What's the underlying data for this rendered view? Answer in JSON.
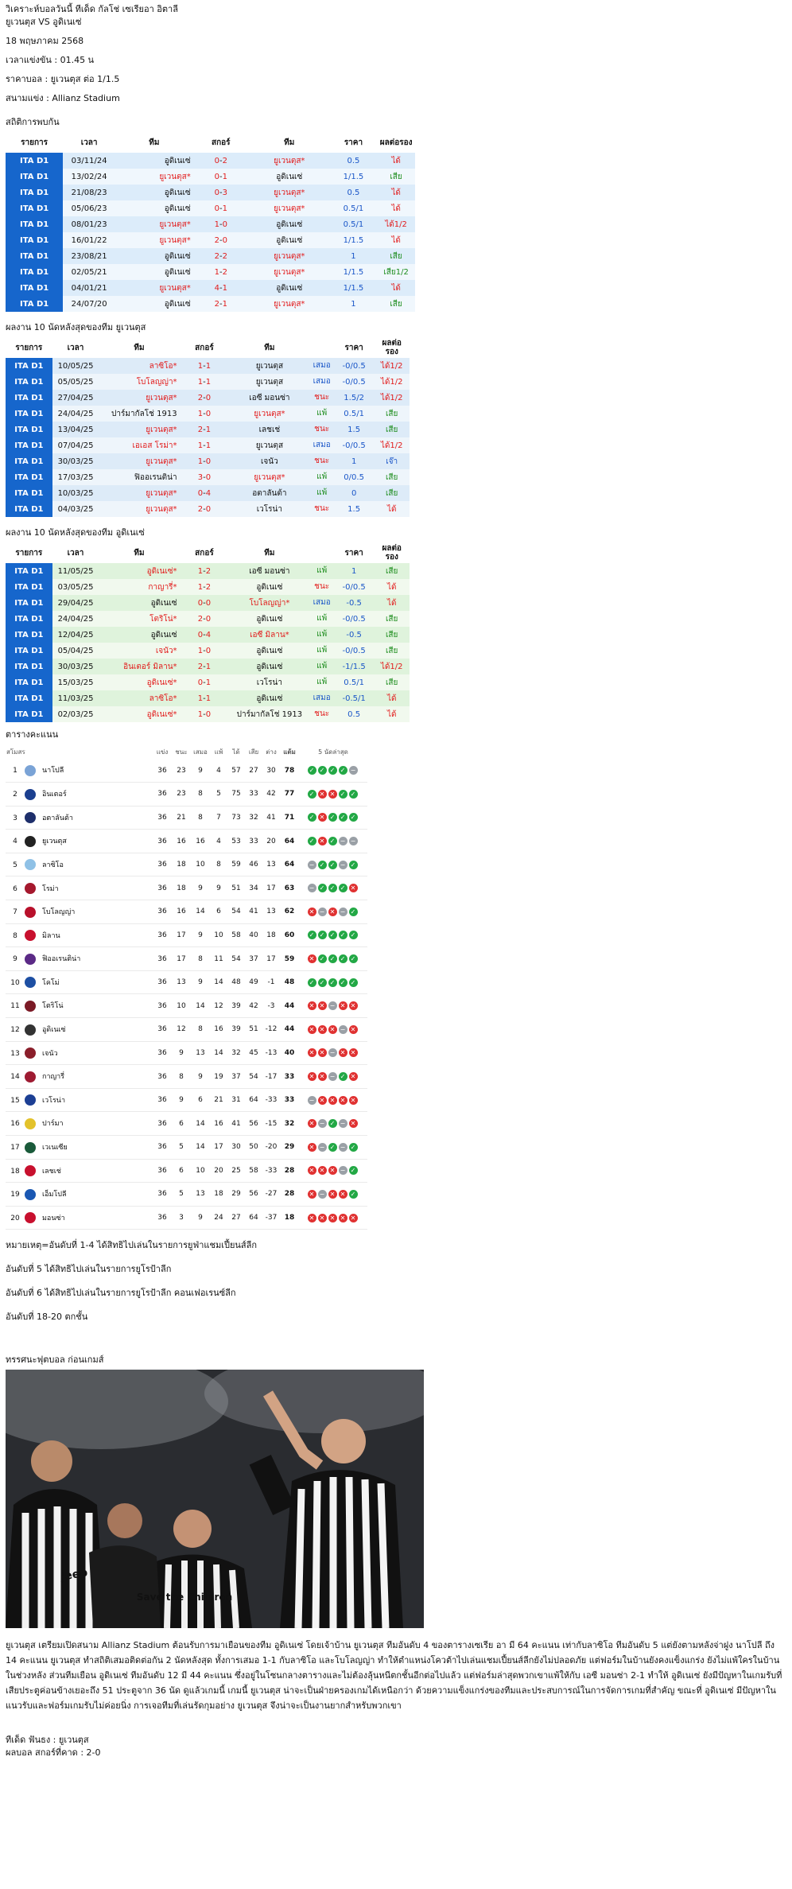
{
  "header": {
    "title": "วิเคราะห์บอลวันนี้ ทีเด็ด กัลโช่ เซเรียอา อิตาลี",
    "match": "ยูเวนตุส VS อูดิเนเซ่",
    "date": "18 พฤษภาคม 2568",
    "kickoff": "เวลาแข่งขัน : 01.45 น",
    "odds": "ราคาบอล : ยูเวนตุส ต่อ 1/1.5",
    "stadium": "สนามแข่ง : Allianz Stadium"
  },
  "h2h": {
    "title": "สถิติการพบกัน",
    "headers": [
      "รายการ",
      "เวลา",
      "ทีม",
      "สกอร์",
      "ทีม",
      "ราคา",
      "ผลต่อรอง"
    ],
    "rows": [
      {
        "league": "ITA D1",
        "date": "03/11/24",
        "home": "อูดิเนเซ่",
        "score_h": "0",
        "score_a": "2",
        "away": "ยูเวนตุส*",
        "odds": "0.5",
        "result": "ได้"
      },
      {
        "league": "ITA D1",
        "date": "13/02/24",
        "home": "ยูเวนตุส*",
        "score_h": "0",
        "score_a": "1",
        "away": "อูดิเนเซ่",
        "odds": "1/1.5",
        "result": "เสีย"
      },
      {
        "league": "ITA D1",
        "date": "21/08/23",
        "home": "อูดิเนเซ่",
        "score_h": "0",
        "score_a": "3",
        "away": "ยูเวนตุส*",
        "odds": "0.5",
        "result": "ได้"
      },
      {
        "league": "ITA D1",
        "date": "05/06/23",
        "home": "อูดิเนเซ่",
        "score_h": "0",
        "score_a": "1",
        "away": "ยูเวนตุส*",
        "odds": "0.5/1",
        "result": "ได้"
      },
      {
        "league": "ITA D1",
        "date": "08/01/23",
        "home": "ยูเวนตุส*",
        "score_h": "1",
        "score_a": "0",
        "away": "อูดิเนเซ่",
        "odds": "0.5/1",
        "result": "ได้1/2"
      },
      {
        "league": "ITA D1",
        "date": "16/01/22",
        "home": "ยูเวนตุส*",
        "score_h": "2",
        "score_a": "0",
        "away": "อูดิเนเซ่",
        "odds": "1/1.5",
        "result": "ได้"
      },
      {
        "league": "ITA D1",
        "date": "23/08/21",
        "home": "อูดิเนเซ่",
        "score_h": "2",
        "score_a": "2",
        "away": "ยูเวนตุส*",
        "odds": "1",
        "result": "เสีย"
      },
      {
        "league": "ITA D1",
        "date": "02/05/21",
        "home": "อูดิเนเซ่",
        "score_h": "1",
        "score_a": "2",
        "away": "ยูเวนตุส*",
        "odds": "1/1.5",
        "result": "เสีย1/2"
      },
      {
        "league": "ITA D1",
        "date": "04/01/21",
        "home": "ยูเวนตุส*",
        "score_h": "4",
        "score_a": "1",
        "away": "อูดิเนเซ่",
        "odds": "1/1.5",
        "result": "ได้"
      },
      {
        "league": "ITA D1",
        "date": "24/07/20",
        "home": "อูดิเนเซ่",
        "score_h": "2",
        "score_a": "1",
        "away": "ยูเวนตุส*",
        "odds": "1",
        "result": "เสีย"
      }
    ]
  },
  "juve_form": {
    "title": "ผลงาน 10 นัดหลังสุดของทีม ยูเวนตุส",
    "headers": [
      "รายการ",
      "เวลา",
      "ทีม",
      "สกอร์",
      "ทีม",
      "",
      "ราคา",
      "ผลต่อรอง"
    ],
    "rows": [
      {
        "league": "ITA D1",
        "date": "10/05/25",
        "home": "ลาซิโอ*",
        "score_h": "1",
        "score_a": "1",
        "away": "ยูเวนตุส",
        "wdl": "เสมอ",
        "odds": "-0/0.5",
        "result": "ได้1/2"
      },
      {
        "league": "ITA D1",
        "date": "05/05/25",
        "home": "โบโลญญ่า*",
        "score_h": "1",
        "score_a": "1",
        "away": "ยูเวนตุส",
        "wdl": "เสมอ",
        "odds": "-0/0.5",
        "result": "ได้1/2"
      },
      {
        "league": "ITA D1",
        "date": "27/04/25",
        "home": "ยูเวนตุส*",
        "score_h": "2",
        "score_a": "0",
        "away": "เอซี มอนซ่า",
        "wdl": "ชนะ",
        "odds": "1.5/2",
        "result": "ได้1/2"
      },
      {
        "league": "ITA D1",
        "date": "24/04/25",
        "home": "ปาร์มากัลโช่ 1913",
        "score_h": "1",
        "score_a": "0",
        "away": "ยูเวนตุส*",
        "wdl": "แพ้",
        "odds": "0.5/1",
        "result": "เสีย"
      },
      {
        "league": "ITA D1",
        "date": "13/04/25",
        "home": "ยูเวนตุส*",
        "score_h": "2",
        "score_a": "1",
        "away": "เลชเช่",
        "wdl": "ชนะ",
        "odds": "1.5",
        "result": "เสีย"
      },
      {
        "league": "ITA D1",
        "date": "07/04/25",
        "home": "เอเอส โรม่า*",
        "score_h": "1",
        "score_a": "1",
        "away": "ยูเวนตุส",
        "wdl": "เสมอ",
        "odds": "-0/0.5",
        "result": "ได้1/2"
      },
      {
        "league": "ITA D1",
        "date": "30/03/25",
        "home": "ยูเวนตุส*",
        "score_h": "1",
        "score_a": "0",
        "away": "เจนัว",
        "wdl": "ชนะ",
        "odds": "1",
        "result": "เจ๊า"
      },
      {
        "league": "ITA D1",
        "date": "17/03/25",
        "home": "ฟิออเรนติน่า",
        "score_h": "3",
        "score_a": "0",
        "away": "ยูเวนตุส*",
        "wdl": "แพ้",
        "odds": "0/0.5",
        "result": "เสีย"
      },
      {
        "league": "ITA D1",
        "date": "10/03/25",
        "home": "ยูเวนตุส*",
        "score_h": "0",
        "score_a": "4",
        "away": "อตาลันต้า",
        "wdl": "แพ้",
        "odds": "0",
        "result": "เสีย"
      },
      {
        "league": "ITA D1",
        "date": "04/03/25",
        "home": "ยูเวนตุส*",
        "score_h": "2",
        "score_a": "0",
        "away": "เวโรน่า",
        "wdl": "ชนะ",
        "odds": "1.5",
        "result": "ได้"
      }
    ]
  },
  "udinese_form": {
    "title": "ผลงาน 10 นัดหลังสุดของทีม อูดิเนเซ่",
    "headers": [
      "รายการ",
      "เวลา",
      "ทีม",
      "สกอร์",
      "ทีม",
      "",
      "ราคา",
      "ผลต่อรอง"
    ],
    "rows": [
      {
        "league": "ITA D1",
        "date": "11/05/25",
        "home": "อูดิเนเซ่*",
        "score_h": "1",
        "score_a": "2",
        "away": "เอซี มอนซ่า",
        "wdl": "แพ้",
        "odds": "1",
        "result": "เสีย"
      },
      {
        "league": "ITA D1",
        "date": "03/05/25",
        "home": "กาญารี่*",
        "score_h": "1",
        "score_a": "2",
        "away": "อูดิเนเซ่",
        "wdl": "ชนะ",
        "odds": "-0/0.5",
        "result": "ได้"
      },
      {
        "league": "ITA D1",
        "date": "29/04/25",
        "home": "อูดิเนเซ่",
        "score_h": "0",
        "score_a": "0",
        "away": "โบโลญญ่า*",
        "wdl": "เสมอ",
        "odds": "-0.5",
        "result": "ได้"
      },
      {
        "league": "ITA D1",
        "date": "24/04/25",
        "home": "โตริโน่*",
        "score_h": "2",
        "score_a": "0",
        "away": "อูดิเนเซ่",
        "wdl": "แพ้",
        "odds": "-0/0.5",
        "result": "เสีย"
      },
      {
        "league": "ITA D1",
        "date": "12/04/25",
        "home": "อูดิเนเซ่",
        "score_h": "0",
        "score_a": "4",
        "away": "เอซี มิลาน*",
        "wdl": "แพ้",
        "odds": "-0.5",
        "result": "เสีย"
      },
      {
        "league": "ITA D1",
        "date": "05/04/25",
        "home": "เจนัว*",
        "score_h": "1",
        "score_a": "0",
        "away": "อูดิเนเซ่",
        "wdl": "แพ้",
        "odds": "-0/0.5",
        "result": "เสีย"
      },
      {
        "league": "ITA D1",
        "date": "30/03/25",
        "home": "อินเตอร์ มิลาน*",
        "score_h": "2",
        "score_a": "1",
        "away": "อูดิเนเซ่",
        "wdl": "แพ้",
        "odds": "-1/1.5",
        "result": "ได้1/2"
      },
      {
        "league": "ITA D1",
        "date": "15/03/25",
        "home": "อูดิเนเซ่*",
        "score_h": "0",
        "score_a": "1",
        "away": "เวโรน่า",
        "wdl": "แพ้",
        "odds": "0.5/1",
        "result": "เสีย"
      },
      {
        "league": "ITA D1",
        "date": "11/03/25",
        "home": "ลาซิโอ*",
        "score_h": "1",
        "score_a": "1",
        "away": "อูดิเนเซ่",
        "wdl": "เสมอ",
        "odds": "-0.5/1",
        "result": "ได้"
      },
      {
        "league": "ITA D1",
        "date": "02/03/25",
        "home": "อูดิเนเซ่*",
        "score_h": "1",
        "score_a": "0",
        "away": "ปาร์มากัลโช่ 1913",
        "wdl": "ชนะ",
        "odds": "0.5",
        "result": "ได้"
      }
    ]
  },
  "standings": {
    "title": "ตารางคะแนน",
    "headers": [
      "สโมสร",
      "แข่ง",
      "ชนะ",
      "เสมอ",
      "แพ้",
      "ได้",
      "เสีย",
      "ต่าง",
      "แต้ม",
      "5 นัดล่าสุด"
    ],
    "rows": [
      {
        "pos": "1",
        "team": "นาโปลี",
        "crest": "#7aa3d6",
        "p": "36",
        "w": "23",
        "d": "9",
        "l": "4",
        "gf": "57",
        "ga": "27",
        "gd": "30",
        "pts": "78",
        "form": [
          "W",
          "W",
          "W",
          "W",
          "D"
        ]
      },
      {
        "pos": "2",
        "team": "อินเตอร์",
        "crest": "#1b3f8f",
        "p": "36",
        "w": "23",
        "d": "8",
        "l": "5",
        "gf": "75",
        "ga": "33",
        "gd": "42",
        "pts": "77",
        "form": [
          "W",
          "L",
          "L",
          "W",
          "W"
        ]
      },
      {
        "pos": "3",
        "team": "อตาลันต้า",
        "crest": "#1e2f6b",
        "p": "36",
        "w": "21",
        "d": "8",
        "l": "7",
        "gf": "73",
        "ga": "32",
        "gd": "41",
        "pts": "71",
        "form": [
          "W",
          "L",
          "W",
          "W",
          "W"
        ]
      },
      {
        "pos": "4",
        "team": "ยูเวนตุส",
        "crest": "#222222",
        "p": "36",
        "w": "16",
        "d": "16",
        "l": "4",
        "gf": "53",
        "ga": "33",
        "gd": "20",
        "pts": "64",
        "form": [
          "W",
          "L",
          "W",
          "D",
          "D"
        ]
      },
      {
        "pos": "5",
        "team": "ลาซิโอ",
        "crest": "#8fc1e6",
        "p": "36",
        "w": "18",
        "d": "10",
        "l": "8",
        "gf": "59",
        "ga": "46",
        "gd": "13",
        "pts": "64",
        "form": [
          "D",
          "W",
          "W",
          "D",
          "W"
        ]
      },
      {
        "pos": "6",
        "team": "โรม่า",
        "crest": "#a5182d",
        "p": "36",
        "w": "18",
        "d": "9",
        "l": "9",
        "gf": "51",
        "ga": "34",
        "gd": "17",
        "pts": "63",
        "form": [
          "D",
          "W",
          "W",
          "W",
          "L"
        ]
      },
      {
        "pos": "7",
        "team": "โบโลญญ่า",
        "crest": "#b8102b",
        "p": "36",
        "w": "16",
        "d": "14",
        "l": "6",
        "gf": "54",
        "ga": "41",
        "gd": "13",
        "pts": "62",
        "form": [
          "L",
          "D",
          "L",
          "D",
          "W"
        ]
      },
      {
        "pos": "8",
        "team": "มิลาน",
        "crest": "#c8102e",
        "p": "36",
        "w": "17",
        "d": "9",
        "l": "10",
        "gf": "58",
        "ga": "40",
        "gd": "18",
        "pts": "60",
        "form": [
          "W",
          "W",
          "W",
          "W",
          "W"
        ]
      },
      {
        "pos": "9",
        "team": "ฟิออเรนติน่า",
        "crest": "#5b2a86",
        "p": "36",
        "w": "17",
        "d": "8",
        "l": "11",
        "gf": "54",
        "ga": "37",
        "gd": "17",
        "pts": "59",
        "form": [
          "L",
          "W",
          "W",
          "W",
          "W"
        ]
      },
      {
        "pos": "10",
        "team": "โคโม่",
        "crest": "#1d4fa3",
        "p": "36",
        "w": "13",
        "d": "9",
        "l": "14",
        "gf": "48",
        "ga": "49",
        "gd": "-1",
        "pts": "48",
        "form": [
          "W",
          "W",
          "W",
          "W",
          "W"
        ]
      },
      {
        "pos": "11",
        "team": "โตริโน่",
        "crest": "#7b1a26",
        "p": "36",
        "w": "10",
        "d": "14",
        "l": "12",
        "gf": "39",
        "ga": "42",
        "gd": "-3",
        "pts": "44",
        "form": [
          "L",
          "L",
          "D",
          "L",
          "L"
        ]
      },
      {
        "pos": "12",
        "team": "อูดิเนเซ่",
        "crest": "#333333",
        "p": "36",
        "w": "12",
        "d": "8",
        "l": "16",
        "gf": "39",
        "ga": "51",
        "gd": "-12",
        "pts": "44",
        "form": [
          "L",
          "L",
          "L",
          "D",
          "L"
        ]
      },
      {
        "pos": "13",
        "team": "เจนัว",
        "crest": "#8a1e2a",
        "p": "36",
        "w": "9",
        "d": "13",
        "l": "14",
        "gf": "32",
        "ga": "45",
        "gd": "-13",
        "pts": "40",
        "form": [
          "L",
          "L",
          "D",
          "L",
          "L"
        ]
      },
      {
        "pos": "14",
        "team": "กาญารี่",
        "crest": "#9e1b32",
        "p": "36",
        "w": "8",
        "d": "9",
        "l": "19",
        "gf": "37",
        "ga": "54",
        "gd": "-17",
        "pts": "33",
        "form": [
          "L",
          "L",
          "D",
          "W",
          "L"
        ]
      },
      {
        "pos": "15",
        "team": "เวโรน่า",
        "crest": "#1c3f94",
        "p": "36",
        "w": "9",
        "d": "6",
        "l": "21",
        "gf": "31",
        "ga": "64",
        "gd": "-33",
        "pts": "33",
        "form": [
          "D",
          "L",
          "L",
          "L",
          "L"
        ]
      },
      {
        "pos": "16",
        "team": "ปาร์มา",
        "crest": "#e3c22b",
        "p": "36",
        "w": "6",
        "d": "14",
        "l": "16",
        "gf": "41",
        "ga": "56",
        "gd": "-15",
        "pts": "32",
        "form": [
          "L",
          "D",
          "W",
          "D",
          "L"
        ]
      },
      {
        "pos": "17",
        "team": "เวเนเซีย",
        "crest": "#1a5a3a",
        "p": "36",
        "w": "5",
        "d": "14",
        "l": "17",
        "gf": "30",
        "ga": "50",
        "gd": "-20",
        "pts": "29",
        "form": [
          "L",
          "D",
          "W",
          "D",
          "W"
        ]
      },
      {
        "pos": "18",
        "team": "เลชเช่",
        "crest": "#c8102e",
        "p": "36",
        "w": "6",
        "d": "10",
        "l": "20",
        "gf": "25",
        "ga": "58",
        "gd": "-33",
        "pts": "28",
        "form": [
          "L",
          "L",
          "L",
          "D",
          "W"
        ]
      },
      {
        "pos": "19",
        "team": "เอ็มโปลี",
        "crest": "#1a58b3",
        "p": "36",
        "w": "5",
        "d": "13",
        "l": "18",
        "gf": "29",
        "ga": "56",
        "gd": "-27",
        "pts": "28",
        "form": [
          "L",
          "D",
          "L",
          "L",
          "W"
        ]
      },
      {
        "pos": "20",
        "team": "มอนซ่า",
        "crest": "#c8102e",
        "p": "36",
        "w": "3",
        "d": "9",
        "l": "24",
        "gf": "27",
        "ga": "64",
        "gd": "-37",
        "pts": "18",
        "form": [
          "L",
          "L",
          "L",
          "L",
          "L"
        ]
      }
    ]
  },
  "notes": [
    "หมายเหตุ=อันดับที่ 1-4 ได้สิทธิไปเล่นในรายการยูฟ่าแชมเปี้ยนส์ลีก",
    "อันดับที่ 5 ได้สิทธิไปเล่นในรายการยูโรป้าลีก",
    "อันดับที่ 6 ได้สิทธิไปเล่นในรายการยูโรป้าลีก คอนเฟอเรนซ์ลีก",
    "อันดับที่ 18-20 ตกชั้น"
  ],
  "preview_title": "ทรรศนะฟุตบอล ก่อนเกมส์",
  "photo_text": "Save the Children",
  "photo_alt_brand": "Jeep",
  "analysis": "ยูเวนตุส เตรียมเปิดสนาม Allianz Stadium ต้อนรับการมาเยือนของทีม อูดิเนเซ่ โดยเจ้าบ้าน ยูเวนตุส ทีมอันดับ 4 ของตารางเซเรีย อา มี 64 คะแนน เท่ากับลาซิโอ ทีมอันดับ 5 แต่ยังตามหลังจ่าฝูง นาโปลี ถึง 14 คะแนน ยูเวนตุส ทำสถิติเสมอติดต่อกัน 2 นัดหลังสุด ทั้งการเสมอ 1-1 กับลาซิโอ และโบโลญญ่า ทำให้ตำแหน่งโควต้าไปเล่นแชมเปี้ยนส์ลีกยังไม่ปลอดภัย แต่ฟอร์มในบ้านยังคงแข็งแกร่ง ยังไม่แพ้ใครในบ้านในช่วงหลัง ส่วนทีมเยือน อูดิเนเซ่ ทีมอันดับ 12 มี 44 คะแนน ซึ่งอยู่ในโซนกลางตารางและไม่ต้องลุ้นหนีตกชั้นอีกต่อไปแล้ว แต่ฟอร์มล่าสุดพวกเขาแพ้ให้กับ เอซี มอนซ่า 2-1 ทำให้ อูดิเนเซ่ ยังมีปัญหาในเกมรับที่เสียประตูค่อนข้างเยอะถึง 51 ประตูจาก 36 นัด ดูแล้วเกมนี้ เกมนี้ ยูเวนตุส น่าจะเป็นฝ่ายครองเกมได้เหนือกว่า ด้วยความแข็งแกร่งของทีมและประสบการณ์ในการจัดการเกมที่สำคัญ ขณะที่ อูดิเนเซ่ มีปัญหาในแนวรับและฟอร์มเกมรับไม่ค่อยนิ่ง การเจอทีมที่เล่นรัดกุมอย่าง ยูเวนตุส จึงน่าจะเป็นงานยากสำหรับพวกเขา",
  "pick": "ทีเด็ด ฟันธง : ยูเวนตุส",
  "predicted_score": "ผลบอล สกอร์ที่คาด : 2-0"
}
